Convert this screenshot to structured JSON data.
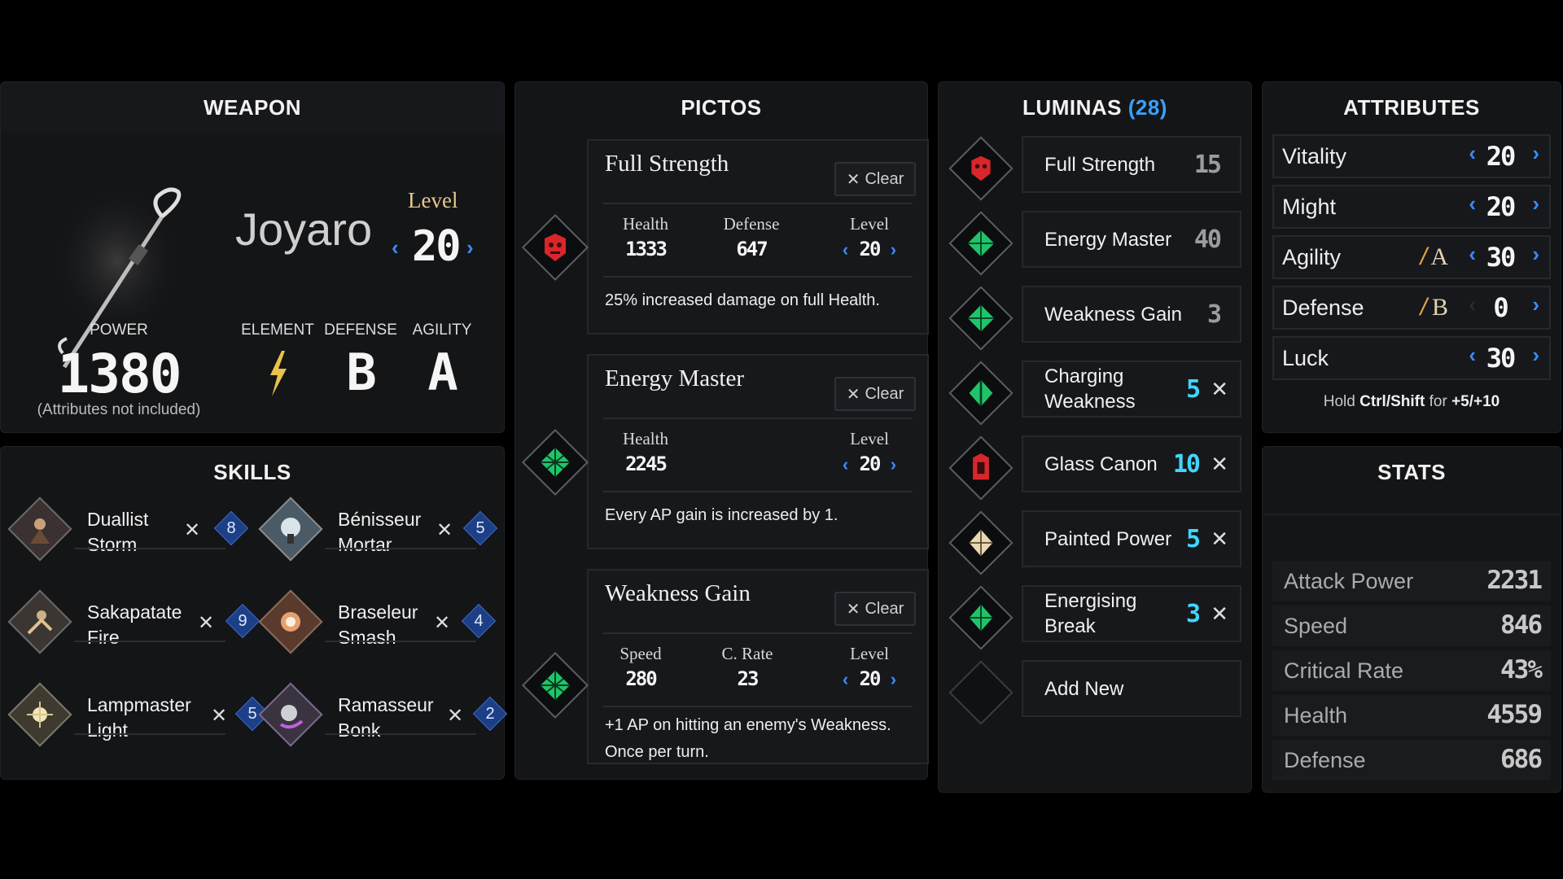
{
  "weapon": {
    "title": "WEAPON",
    "name": "Joyaro",
    "level_label": "Level",
    "level": "20",
    "power_label": "POWER",
    "power": "1380",
    "power_note": "(Attributes not included)",
    "element_label": "ELEMENT",
    "element_icon": "lightning-icon",
    "defense_label": "DEFENSE",
    "defense": "B",
    "agility_label": "AGILITY",
    "agility": "A"
  },
  "skills": {
    "title": "SKILLS",
    "items": [
      {
        "name_line1": "Duallist",
        "name_line2": "Storm",
        "cost": "8"
      },
      {
        "name_line1": "Bénisseur",
        "name_line2": "Mortar",
        "cost": "5"
      },
      {
        "name_line1": "Sakapatate",
        "name_line2": "Fire",
        "cost": "9"
      },
      {
        "name_line1": "Braseleur",
        "name_line2": "Smash",
        "cost": "4"
      },
      {
        "name_line1": "Lampmaster",
        "name_line2": "Light",
        "cost": "5"
      },
      {
        "name_line1": "Ramasseur",
        "name_line2": "Bonk",
        "cost": "2"
      }
    ]
  },
  "pictos": {
    "title": "PICTOS",
    "clear_label": "Clear",
    "items": [
      {
        "name": "Full Strength",
        "stat1_label": "Health",
        "stat1_value": "1333",
        "stat2_label": "Defense",
        "stat2_value": "647",
        "level_label": "Level",
        "level": "20",
        "desc1": "25% increased damage on full Health.",
        "desc2": ""
      },
      {
        "name": "Energy Master",
        "stat1_label": "Health",
        "stat1_value": "2245",
        "stat2_label": "",
        "stat2_value": "",
        "level_label": "Level",
        "level": "20",
        "desc1": "Every AP gain is increased by 1.",
        "desc2": ""
      },
      {
        "name": "Weakness Gain",
        "stat1_label": "Speed",
        "stat1_value": "280",
        "stat2_label": "C. Rate",
        "stat2_value": "23",
        "level_label": "Level",
        "level": "20",
        "desc1": "+1 AP on hitting an enemy's Weakness.",
        "desc2": "Once per turn."
      }
    ]
  },
  "luminas": {
    "title": "LUMINAS",
    "count": "(28)",
    "add_new": "Add New",
    "items": [
      {
        "name_line1": "Full Strength",
        "name_line2": "",
        "cost": "15",
        "removable": false
      },
      {
        "name_line1": "Energy Master",
        "name_line2": "",
        "cost": "40",
        "removable": false
      },
      {
        "name_line1": "Weakness Gain",
        "name_line2": "",
        "cost": "3",
        "removable": false
      },
      {
        "name_line1": "Charging",
        "name_line2": "Weakness",
        "cost": "5",
        "removable": true
      },
      {
        "name_line1": "Glass Canon",
        "name_line2": "",
        "cost": "10",
        "removable": true
      },
      {
        "name_line1": "Painted Power",
        "name_line2": "",
        "cost": "5",
        "removable": true
      },
      {
        "name_line1": "Energising",
        "name_line2": "Break",
        "cost": "3",
        "removable": true
      }
    ]
  },
  "attributes": {
    "title": "ATTRIBUTES",
    "items": [
      {
        "name": "Vitality",
        "value": "20",
        "grade": ""
      },
      {
        "name": "Might",
        "value": "20",
        "grade": ""
      },
      {
        "name": "Agility",
        "value": "30",
        "grade": "A"
      },
      {
        "name": "Defense",
        "value": "0",
        "grade": "B"
      },
      {
        "name": "Luck",
        "value": "30",
        "grade": ""
      }
    ],
    "hint_pre": "Hold",
    "hint_keys": "Ctrl/Shift",
    "hint_mid": "for",
    "hint_amount": "+5/+10"
  },
  "stats": {
    "title": "STATS",
    "items": [
      {
        "name": "Attack Power",
        "value": "2231"
      },
      {
        "name": "Speed",
        "value": "846"
      },
      {
        "name": "Critical Rate",
        "value": "43%"
      },
      {
        "name": "Health",
        "value": "4559"
      },
      {
        "name": "Defense",
        "value": "686"
      }
    ]
  },
  "colors": {
    "accent_blue": "#3a8bff",
    "lumina_cost_grey": "#9a9ca0",
    "lumina_cost_cyan": "#3fd6ff",
    "picto_red": "#d8262b",
    "picto_green": "#1fc46a"
  }
}
